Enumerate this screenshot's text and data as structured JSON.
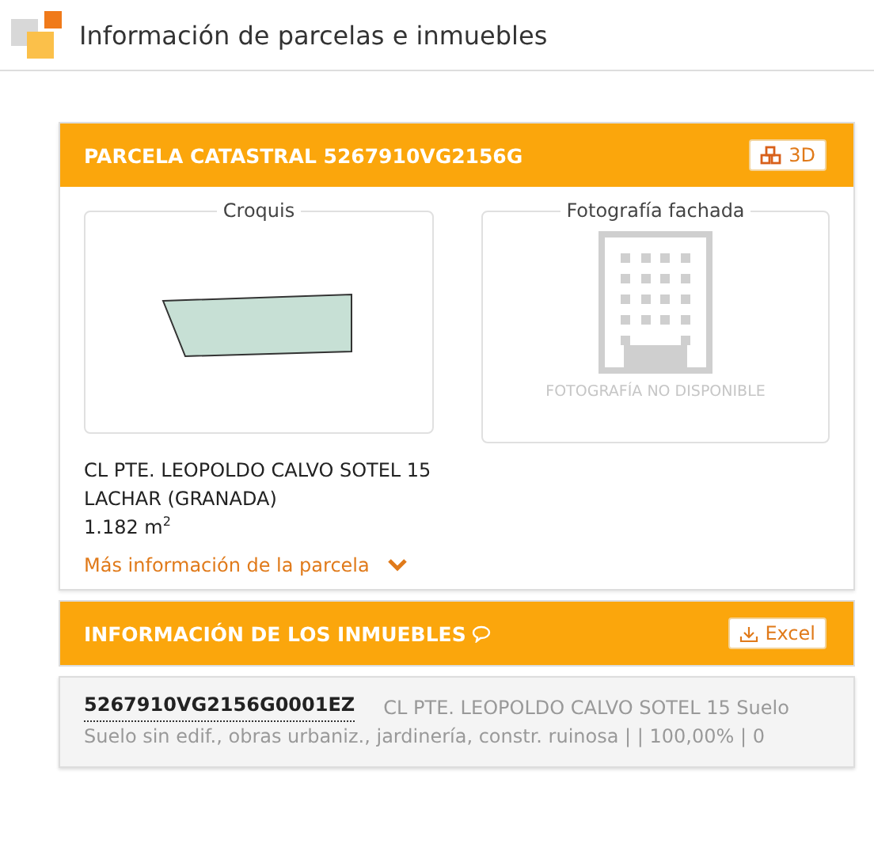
{
  "page_title": "Información de parcelas e inmuebles",
  "parcel": {
    "title": "PARCELA CATASTRAL 5267910VG2156G",
    "button_3d": "3D",
    "sketch_title": "Croquis",
    "photo_title": "Fotografía fachada",
    "photo_unavailable": "FOTOGRAFÍA NO DISPONIBLE",
    "address_lines": [
      "CL PTE. LEOPOLDO CALVO SOTEL 15",
      "LACHAR (GRANADA)",
      "1.182 m$^{2}$"
    ],
    "more_link": "Más información de la parcela",
    "expanded": false
  },
  "properties": {
    "title": "INFORMACIÓN DE LOS INMUEBLES",
    "excel_button": "Excel",
    "rows": [
      {
        "reference": "5267910VG2156G0001EZ",
        "address": "CL PTE. LEOPOLDO CALVO SOTEL 15 Suelo",
        "details": "Suelo sin edif., obras urbaniz., jardinería, constr. ruinosa | | 100,00% | 0"
      }
    ]
  }
}
